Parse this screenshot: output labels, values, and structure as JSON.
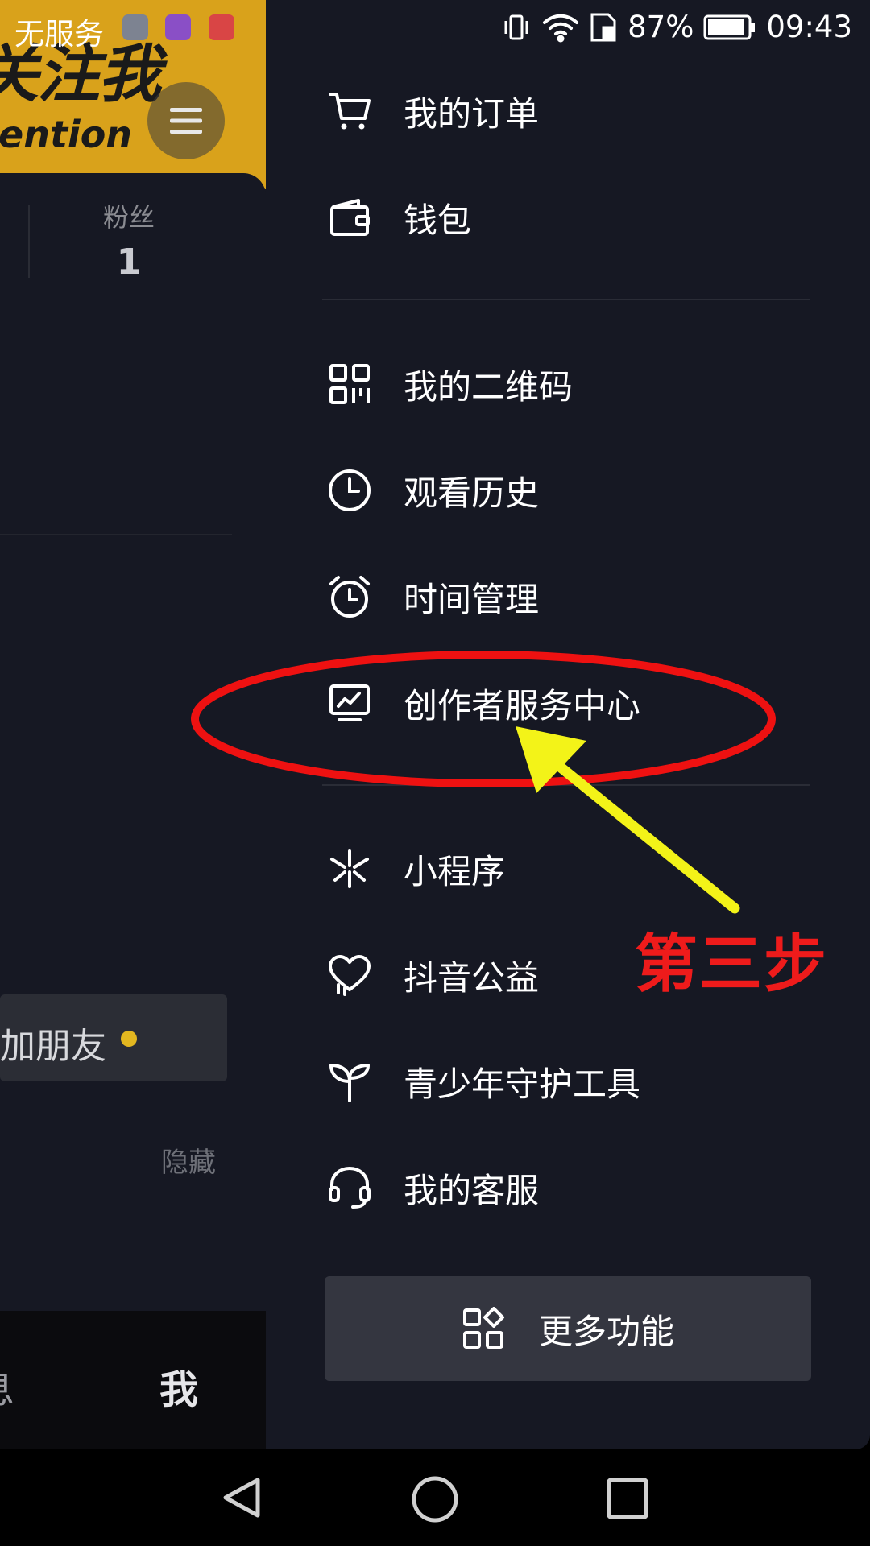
{
  "status_bar": {
    "carrier": "无服务",
    "battery": "87%",
    "time": "09:43"
  },
  "left_panel": {
    "banner_title": "关注我",
    "banner_subtitle": "ention",
    "fans_label": "粉丝",
    "fans_count": "1",
    "add_friend": "加朋友",
    "hide": "隐藏",
    "tab_messages": "息",
    "tab_me": "我"
  },
  "drawer": {
    "items": [
      {
        "label": "我的订单",
        "icon": "cart-icon"
      },
      {
        "label": "钱包",
        "icon": "wallet-icon"
      },
      {
        "label": "我的二维码",
        "icon": "qr-code-icon"
      },
      {
        "label": "观看历史",
        "icon": "clock-icon"
      },
      {
        "label": "时间管理",
        "icon": "alarm-clock-icon"
      },
      {
        "label": "创作者服务中心",
        "icon": "creator-chart-icon"
      },
      {
        "label": "小程序",
        "icon": "mini-program-icon"
      },
      {
        "label": "抖音公益",
        "icon": "charity-heart-icon"
      },
      {
        "label": "青少年守护工具",
        "icon": "sprout-icon"
      },
      {
        "label": "我的客服",
        "icon": "headset-icon"
      }
    ],
    "more_button": "更多功能"
  },
  "annotation": {
    "step_label": "第三步",
    "ellipse_color": "#ee1111",
    "arrow_color": "#f3f318"
  },
  "colors": {
    "drawer_bg": "#161823",
    "banner": "#d9a21b",
    "accent_dot": "#e3b720"
  }
}
